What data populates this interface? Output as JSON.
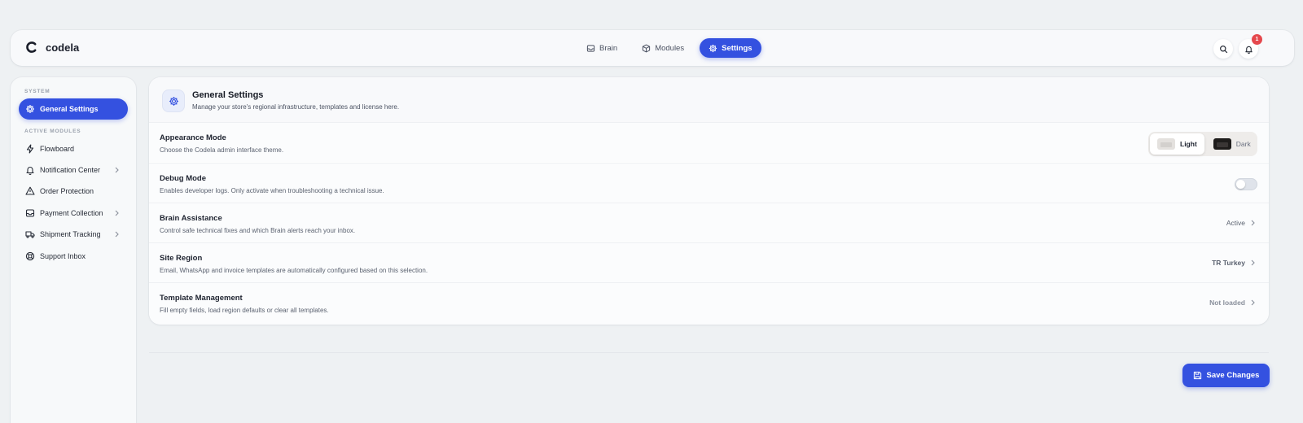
{
  "app": {
    "name": "codela"
  },
  "nav": {
    "items": [
      {
        "label": "Brain",
        "icon": "inbox-icon",
        "active": false
      },
      {
        "label": "Modules",
        "icon": "box-icon",
        "active": false
      },
      {
        "label": "Settings",
        "icon": "gear-icon",
        "active": true
      }
    ]
  },
  "header_actions": {
    "notification_count": "1"
  },
  "sidebar": {
    "system_label": "SYSTEM",
    "modules_label": "ACTIVE MODULES",
    "general": {
      "label": "General Settings",
      "icon": "gear-icon"
    },
    "items": [
      {
        "label": "Flowboard",
        "icon": "bolt-icon",
        "has_chevron": false
      },
      {
        "label": "Notification Center",
        "icon": "bell-icon",
        "has_chevron": true
      },
      {
        "label": "Order Protection",
        "icon": "warning-icon",
        "has_chevron": false
      },
      {
        "label": "Payment Collection",
        "icon": "inbox-icon",
        "has_chevron": true
      },
      {
        "label": "Shipment Tracking",
        "icon": "truck-icon",
        "has_chevron": true
      },
      {
        "label": "Support Inbox",
        "icon": "lifebuoy-icon",
        "has_chevron": false
      }
    ]
  },
  "page": {
    "title": "General Settings",
    "subtitle": "Manage your store's regional infrastructure, templates and license here."
  },
  "settings": {
    "appearance": {
      "title": "Appearance Mode",
      "desc": "Choose the Codela admin interface theme.",
      "light_label": "Light",
      "dark_label": "Dark",
      "selected": "Light"
    },
    "debug": {
      "title": "Debug Mode",
      "desc": "Enables developer logs. Only activate when troubleshooting a technical issue.",
      "enabled": false
    },
    "brain": {
      "title": "Brain Assistance",
      "desc": "Control safe technical fixes and which Brain alerts reach your inbox.",
      "value": "Active"
    },
    "region": {
      "title": "Site Region",
      "desc": "Email, WhatsApp and invoice templates are automatically configured based on this selection.",
      "value": "TR Turkey"
    },
    "templates": {
      "title": "Template Management",
      "desc": "Fill empty fields, load region defaults or clear all templates.",
      "value": "Not loaded"
    }
  },
  "footer": {
    "save_label": "Save Changes"
  },
  "colors": {
    "accent": "#3451e0",
    "badge": "#e5484d",
    "background": "#eef1f3"
  }
}
